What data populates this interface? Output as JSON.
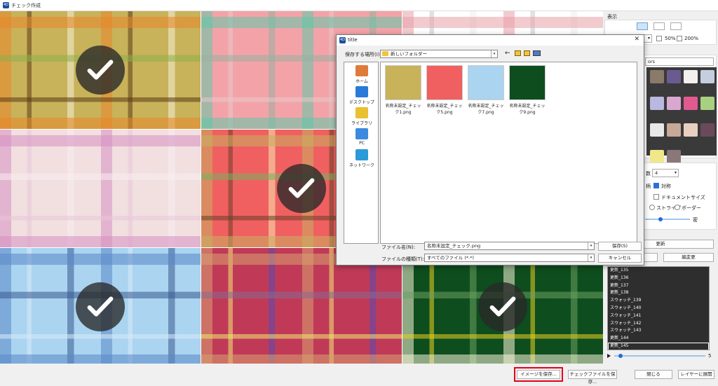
{
  "window": {
    "title": "チェック作成",
    "app_icon": "4D"
  },
  "tiles": [
    {
      "name": "tile-1",
      "colors": [
        "#c8b25a",
        "#e8862a",
        "#5a3a14",
        "#f4f0d8",
        "#8fb04a"
      ],
      "checked": true
    },
    {
      "name": "tile-2",
      "colors": [
        "#f3a3a8",
        "#5fc8a8",
        "#e8c8c8",
        "#9ab0a0"
      ],
      "checked": false
    },
    {
      "name": "tile-3",
      "colors": [
        "#ffffff",
        "#e8a0a8",
        "#c8c8c8",
        "#eeeeee"
      ],
      "checked": false
    },
    {
      "name": "tile-4",
      "colors": [
        "#f2dfe0",
        "#d690c2",
        "#e8c8d8",
        "#f8eef0"
      ],
      "checked": false
    },
    {
      "name": "tile-5",
      "colors": [
        "#f06060",
        "#c8b060",
        "#6a4028",
        "#f7e9b0",
        "#7ab060"
      ],
      "checked": true
    },
    {
      "name": "tile-6",
      "colors": [
        "#aad4f0",
        "#5a88c8",
        "#d8eaf8",
        "#3a5a90"
      ],
      "checked": true
    },
    {
      "name": "tile-7",
      "colors": [
        "#c03a58",
        "#d8a070",
        "#f0e870",
        "#5a4ab0",
        "#8a6a90"
      ],
      "checked": false
    },
    {
      "name": "tile-8",
      "colors": [
        "#0e4d1e",
        "#f8f4d8",
        "#e8d020",
        "#6aa060"
      ],
      "checked": true
    }
  ],
  "panel": {
    "display_label": "表示",
    "zoom_50": "50%",
    "zoom_200": "200%",
    "palette_combo": "ors",
    "swatch_colors": [
      "#8a7a6a",
      "#6a5a90",
      "#f4f0f0",
      "#c5cede",
      "#b8b8e0",
      "#d8a8d0",
      "#e05a90",
      "#a8d080",
      "#e8e8e8",
      "#c8a898",
      "#e8d0c0",
      "#6a4a5a",
      "#f0e888",
      "#8a7878"
    ],
    "count_label": "数",
    "count_value": "4",
    "repeat_label": "柄",
    "symmetric_label": "対称",
    "document_size_label": "ドキュメントサイズ",
    "stripe_label": "ストライプ",
    "border_label": "ボーダー",
    "slider_end_label": "密",
    "update_button": "更新",
    "edit_button": "編変更",
    "history": [
      "更新_135",
      "更新_136",
      "更新_137",
      "更新_138",
      "スウォッチ_139",
      "スウォッチ_140",
      "スウォッチ_141",
      "スウォッチ_142",
      "スウォッチ_143",
      "更新_144",
      "更新_145"
    ],
    "selected_history": "更新_145",
    "playback_end": "5"
  },
  "dialog": {
    "title": "title",
    "location_label": "保存する場所(I):",
    "location_value": "新しいフォルダー",
    "places": [
      "ホーム",
      "デスクトップ",
      "ライブラリ",
      "PC",
      "ネットワーク"
    ],
    "files": [
      {
        "name": "名称未設定_チェック1.png",
        "colors": [
          "#c8b25a",
          "#e8862a",
          "#5a3a14"
        ]
      },
      {
        "name": "名称未設定_チェック5.png",
        "colors": [
          "#f06060",
          "#c8b060",
          "#6a4028"
        ]
      },
      {
        "name": "名称未設定_チェック7.png",
        "colors": [
          "#aad4f0",
          "#5a88c8",
          "#d8eaf8"
        ]
      },
      {
        "name": "名称未設定_チェック9.png",
        "colors": [
          "#0e4d1e",
          "#f8f4d8",
          "#e8d020"
        ]
      }
    ],
    "filename_label": "ファイル名(N):",
    "filename_value": "名称未設定_チェック.png",
    "filetype_label": "ファイルの種類(T):",
    "filetype_value": "すべてのファイル (*.*)",
    "save_button": "保存(S)",
    "cancel_button": "キャンセル"
  },
  "footer": {
    "save_image_button": "イメージを保存...",
    "save_check_file_button": "チェックファイルを保存...",
    "close_button": "閉じる",
    "expand_layers_button": "レイヤーに展開"
  }
}
